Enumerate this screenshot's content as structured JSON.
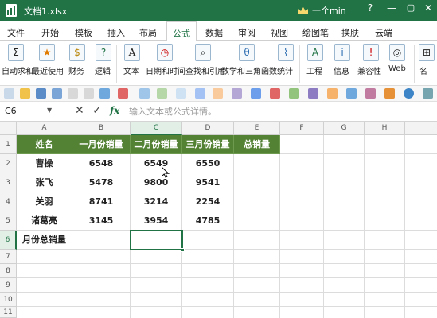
{
  "window": {
    "title": "文档1.xlsx",
    "user": "一个min",
    "help": "?",
    "minimize": "—",
    "maximize": "▢",
    "close": "✕"
  },
  "tabs": [
    "文件",
    "开始",
    "模板",
    "插入",
    "布局",
    "公式",
    "数据",
    "审阅",
    "视图",
    "绘图笔",
    "换肤",
    "云端"
  ],
  "active_tab": "公式",
  "ribbon": {
    "groups": [
      {
        "label": "自动求和",
        "icon": "sum-icon",
        "glyph": "Σ"
      },
      {
        "label": "最近使用",
        "icon": "star-icon",
        "glyph": "★"
      },
      {
        "label": "财务",
        "icon": "money-bag-icon",
        "glyph": "$"
      },
      {
        "label": "逻辑",
        "icon": "question-icon",
        "glyph": "?"
      },
      {
        "label": "文本",
        "icon": "text-icon",
        "glyph": "A"
      },
      {
        "label": "日期和时间",
        "icon": "clock-icon",
        "glyph": "◷"
      },
      {
        "label": "查找和引用",
        "icon": "magnifier-icon",
        "glyph": "⌕"
      },
      {
        "label": "数学和三角函数",
        "icon": "theta-icon",
        "glyph": "θ"
      },
      {
        "label": "统计",
        "icon": "chart-icon",
        "glyph": "⌇"
      },
      {
        "label": "工程",
        "icon": "engineering-icon",
        "glyph": "A"
      },
      {
        "label": "信息",
        "icon": "info-icon",
        "glyph": "i"
      },
      {
        "label": "兼容性",
        "icon": "warning-icon",
        "glyph": "!"
      },
      {
        "label": "Web",
        "icon": "globe-icon",
        "glyph": "◎"
      },
      {
        "label": "名",
        "icon": "name-icon",
        "glyph": "⊞"
      }
    ]
  },
  "formula_bar": {
    "name_box": "C6",
    "cancel": "✕",
    "confirm": "✓",
    "fx": "fx",
    "placeholder": "输入文本或公式详情。"
  },
  "sheet": {
    "columns": [
      "A",
      "B",
      "C",
      "D",
      "E",
      "F",
      "G",
      "H"
    ],
    "rows": [
      "1",
      "2",
      "3",
      "4",
      "5",
      "6",
      "7",
      "8",
      "9",
      "10",
      "11"
    ],
    "selected_cell": "C6",
    "header_row": [
      "姓名",
      "一月份销量",
      "二月份销量",
      "三月份销量",
      "总销量"
    ],
    "data_rows": [
      [
        "曹操",
        "6548",
        "6549",
        "6550",
        ""
      ],
      [
        "张飞",
        "5478",
        "9800",
        "9541",
        ""
      ],
      [
        "关羽",
        "8741",
        "3214",
        "2254",
        ""
      ],
      [
        "诸葛亮",
        "3145",
        "3954",
        "4785",
        ""
      ],
      [
        "月份总销量",
        "",
        "",
        "",
        ""
      ]
    ]
  },
  "colors": {
    "brand": "#217346",
    "header_fill": "#548235",
    "header_text": "#ffffff"
  }
}
